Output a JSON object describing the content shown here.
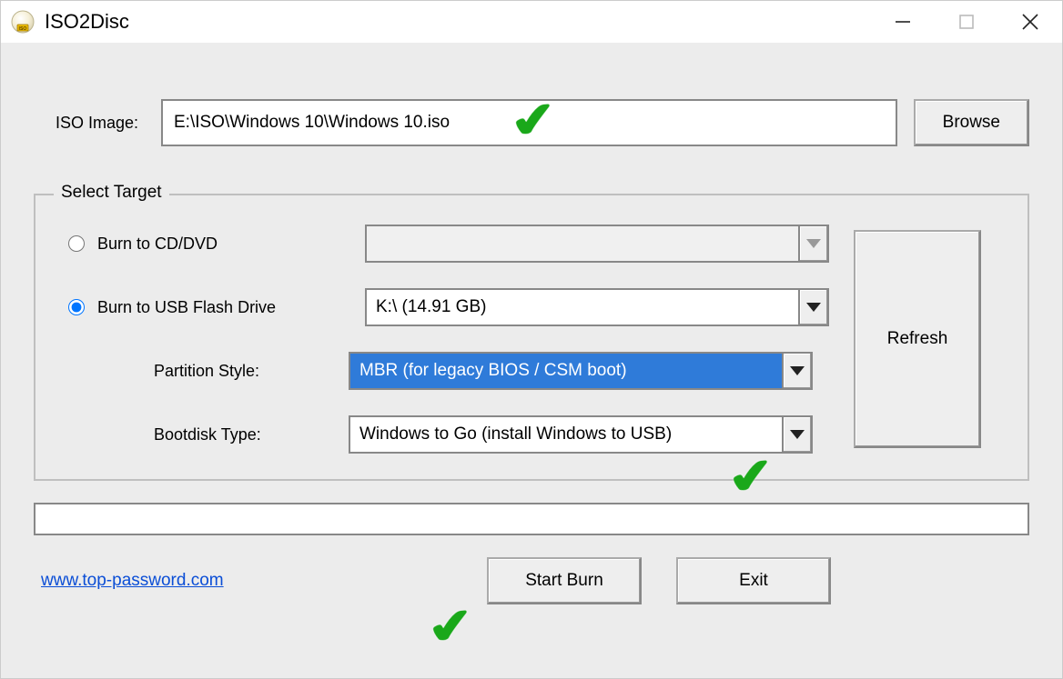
{
  "app": {
    "title": "ISO2Disc"
  },
  "iso": {
    "label": "ISO Image:",
    "value": "E:\\ISO\\Windows 10\\Windows 10.iso",
    "browse_label": "Browse"
  },
  "target": {
    "legend": "Select Target",
    "radio_cd_label": "Burn to CD/DVD",
    "radio_usb_label": "Burn to USB Flash Drive",
    "cd_selected": "",
    "usb_selected": "K:\\ (14.91 GB)",
    "partition_label": "Partition Style:",
    "partition_value": "MBR (for legacy BIOS / CSM boot)",
    "bootdisk_label": "Bootdisk Type:",
    "bootdisk_value": "Windows to Go (install Windows to USB)",
    "refresh_label": "Refresh"
  },
  "footer": {
    "link": "www.top-password.com",
    "start_label": "Start Burn",
    "exit_label": "Exit"
  }
}
